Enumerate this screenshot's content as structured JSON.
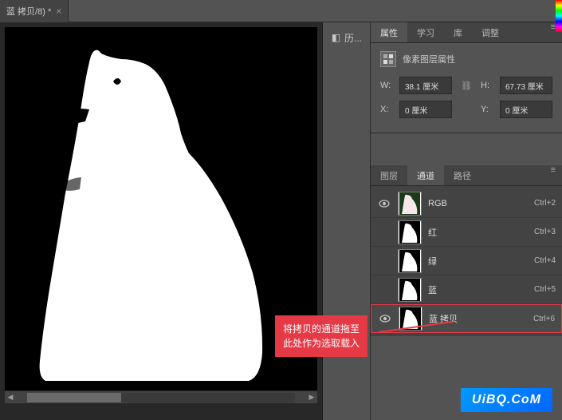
{
  "tab": {
    "title": "蓝 拷贝/8) *"
  },
  "mid": {
    "history_label": "历..."
  },
  "properties": {
    "tabs": {
      "props": "属性",
      "learn": "学习",
      "lib": "库",
      "adjust": "调整"
    },
    "pixel_layer_label": "像素图层属性",
    "W_label": "W:",
    "W_value": "38.1 厘米",
    "H_label": "H:",
    "H_value": "67.73 厘米",
    "X_label": "X:",
    "X_value": "0 厘米",
    "Y_label": "Y:",
    "Y_value": "0 厘米"
  },
  "channel_tabs": {
    "layers": "图层",
    "channels": "通道",
    "paths": "路径"
  },
  "channels": [
    {
      "name": "RGB",
      "shortcut": "Ctrl+2",
      "eye": true,
      "thumb": "color"
    },
    {
      "name": "红",
      "shortcut": "Ctrl+3",
      "eye": false,
      "thumb": "bw"
    },
    {
      "name": "绿",
      "shortcut": "Ctrl+4",
      "eye": false,
      "thumb": "bw"
    },
    {
      "name": "蓝",
      "shortcut": "Ctrl+5",
      "eye": false,
      "thumb": "bw"
    },
    {
      "name": "蓝 拷贝",
      "shortcut": "Ctrl+6",
      "eye": true,
      "thumb": "bw",
      "selected": true
    }
  ],
  "callout": {
    "line1": "将拷贝的通道拖至",
    "line2": "此处作为选取载入"
  },
  "watermark": "UiBQ.CoM"
}
